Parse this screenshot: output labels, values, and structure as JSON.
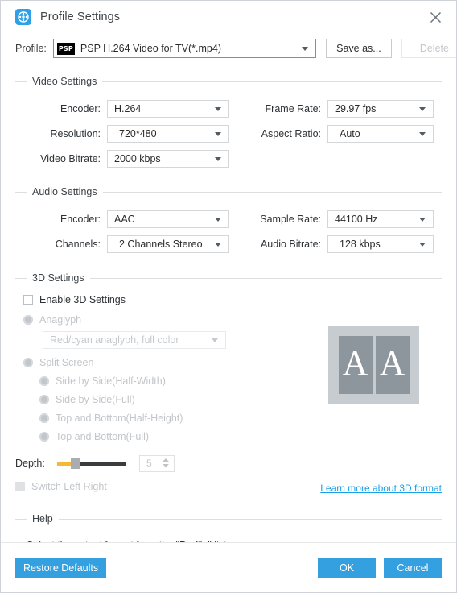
{
  "window": {
    "title": "Profile Settings",
    "app_icon": "film-reel-icon",
    "close_icon": "close-icon"
  },
  "profile_bar": {
    "label": "Profile:",
    "badge": "PSP",
    "value": "PSP H.264 Video for TV(*.mp4)",
    "save_as_label": "Save as...",
    "delete_label": "Delete"
  },
  "video_settings": {
    "group_title": "Video Settings",
    "encoder_label": "Encoder:",
    "encoder_value": "H.264",
    "resolution_label": "Resolution:",
    "resolution_value": "720*480",
    "video_bitrate_label": "Video Bitrate:",
    "video_bitrate_value": "2000 kbps",
    "frame_rate_label": "Frame Rate:",
    "frame_rate_value": "29.97 fps",
    "aspect_ratio_label": "Aspect Ratio:",
    "aspect_ratio_value": "Auto"
  },
  "audio_settings": {
    "group_title": "Audio Settings",
    "encoder_label": "Encoder:",
    "encoder_value": "AAC",
    "channels_label": "Channels:",
    "channels_value": "2 Channels Stereo",
    "sample_rate_label": "Sample Rate:",
    "sample_rate_value": "44100 Hz",
    "audio_bitrate_label": "Audio Bitrate:",
    "audio_bitrate_value": "128 kbps"
  },
  "three_d_settings": {
    "group_title": "3D Settings",
    "enable_label": "Enable 3D Settings",
    "anaglyph_label": "Anaglyph",
    "anaglyph_value": "Red/cyan anaglyph, full color",
    "split_screen_label": "Split Screen",
    "split_options": [
      "Side by Side(Half-Width)",
      "Side by Side(Full)",
      "Top and Bottom(Half-Height)",
      "Top and Bottom(Full)"
    ],
    "depth_label": "Depth:",
    "depth_value": "5",
    "switch_left_right_label": "Switch Left Right",
    "learn_more_label": "Learn more about 3D format",
    "preview_left_letter": "A",
    "preview_right_letter": "A"
  },
  "help": {
    "group_title": "Help",
    "text": "Select the output format from the \"Profile\" list."
  },
  "footer": {
    "restore_label": "Restore Defaults",
    "ok_label": "OK",
    "cancel_label": "Cancel"
  },
  "colors": {
    "accent": "#34a0e0",
    "link": "#18a0e8",
    "slider_fill": "#f6b733",
    "preview_bg": "#c7ccd1"
  }
}
